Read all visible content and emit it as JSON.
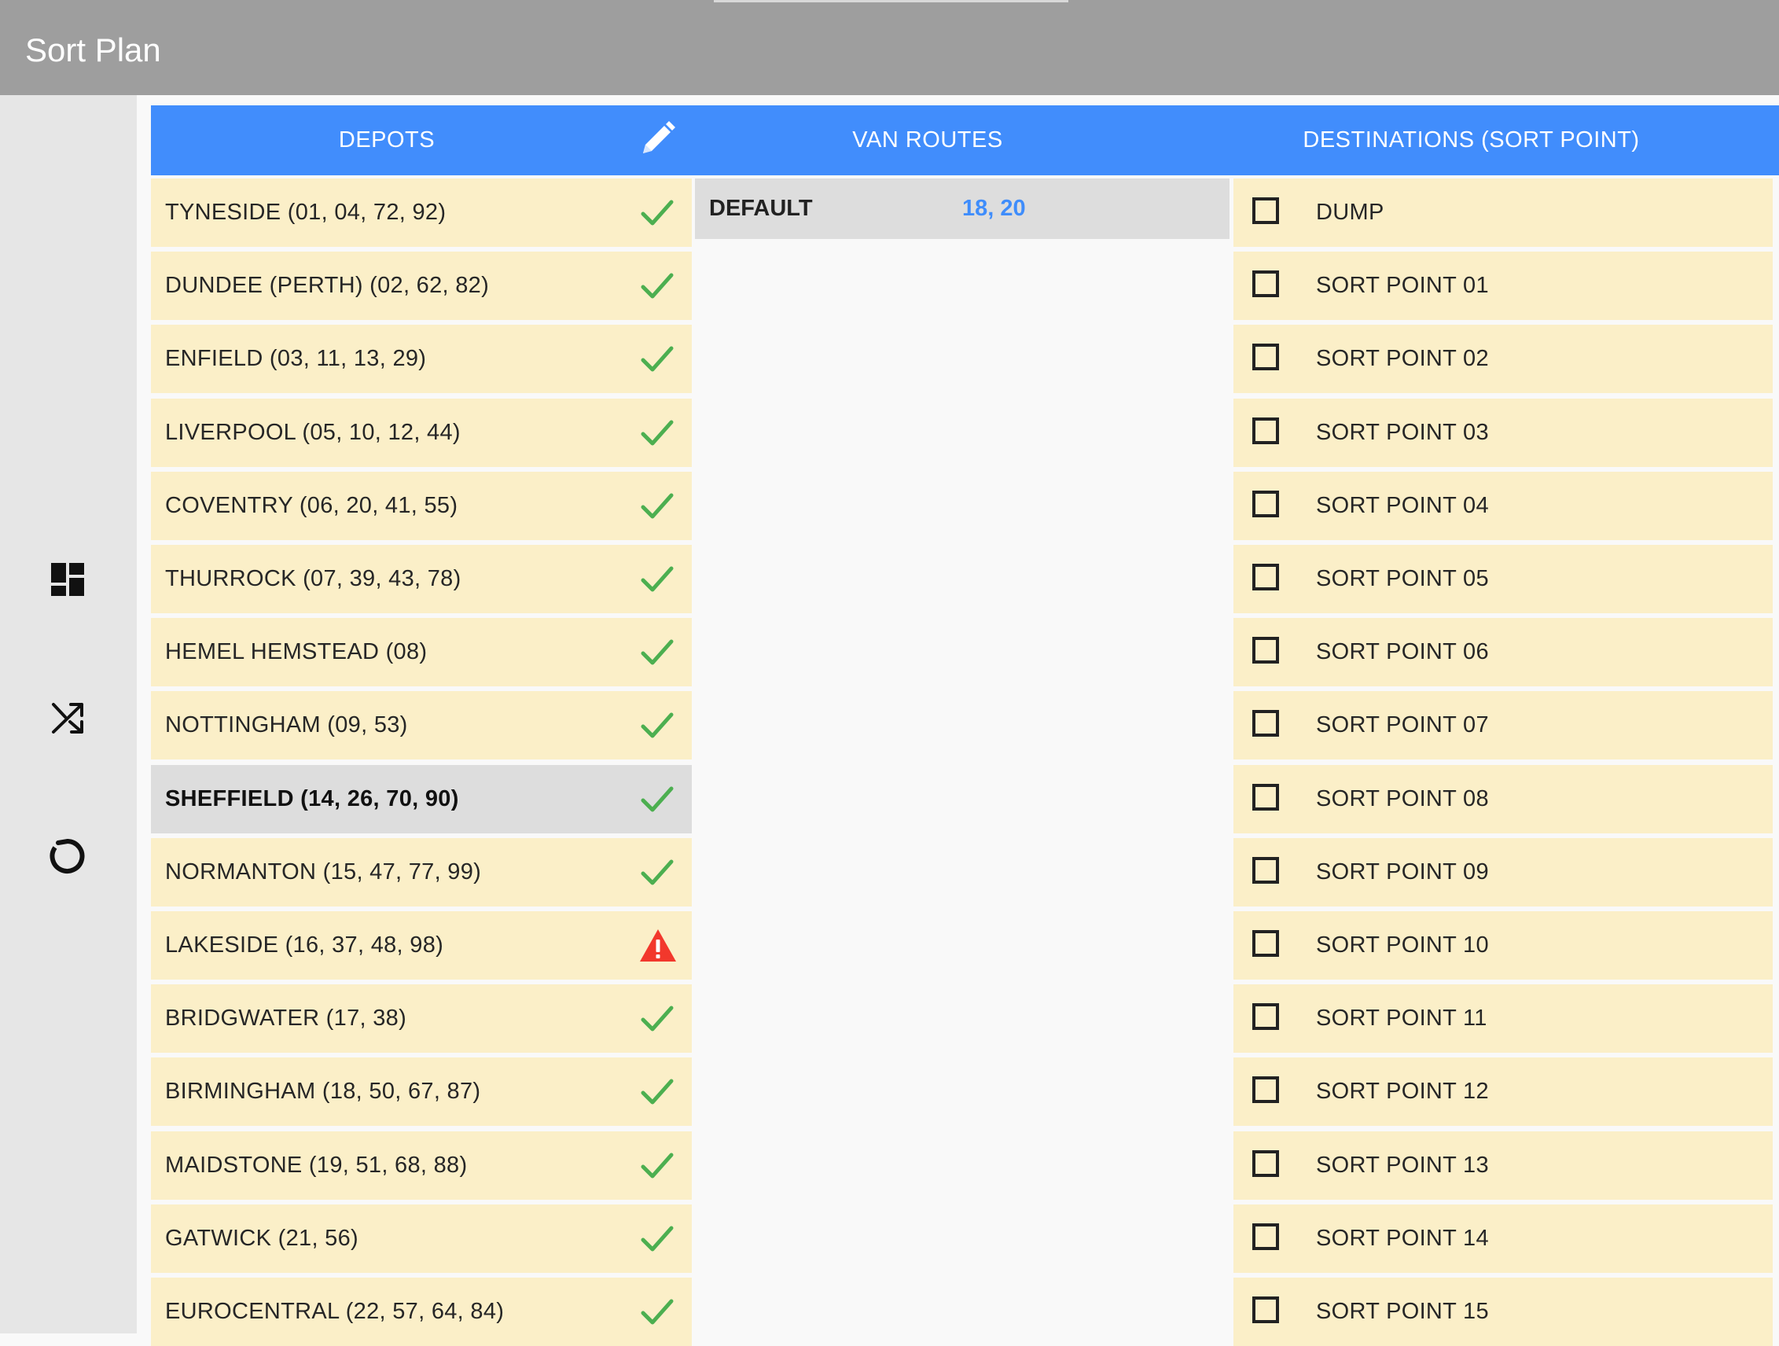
{
  "app": {
    "title": "Sort Plan"
  },
  "sidebar": {
    "items": [
      {
        "icon": "dashboard-icon"
      },
      {
        "icon": "shuffle-icon"
      },
      {
        "icon": "refresh-icon"
      }
    ]
  },
  "headers": {
    "depots": "DEPOTS",
    "van_routes": "VAN ROUTES",
    "destinations": "DESTINATIONS (SORT POINT)"
  },
  "depots": [
    {
      "label": "TYNESIDE (01, 04, 72, 92)",
      "status": "ok"
    },
    {
      "label": "DUNDEE (PERTH) (02, 62, 82)",
      "status": "ok"
    },
    {
      "label": "ENFIELD (03, 11, 13, 29)",
      "status": "ok"
    },
    {
      "label": "LIVERPOOL (05, 10, 12, 44)",
      "status": "ok"
    },
    {
      "label": "COVENTRY (06, 20, 41, 55)",
      "status": "ok"
    },
    {
      "label": "THURROCK (07, 39, 43, 78)",
      "status": "ok"
    },
    {
      "label": "HEMEL HEMSTEAD (08)",
      "status": "ok"
    },
    {
      "label": "NOTTINGHAM (09, 53)",
      "status": "ok"
    },
    {
      "label": "SHEFFIELD (14, 26, 70, 90)",
      "status": "ok",
      "selected": true
    },
    {
      "label": "NORMANTON (15, 47, 77, 99)",
      "status": "ok"
    },
    {
      "label": "LAKESIDE (16, 37, 48, 98)",
      "status": "warning"
    },
    {
      "label": "BRIDGWATER (17, 38)",
      "status": "ok"
    },
    {
      "label": "BIRMINGHAM (18, 50, 67, 87)",
      "status": "ok"
    },
    {
      "label": "MAIDSTONE (19, 51, 68, 88)",
      "status": "ok"
    },
    {
      "label": "GATWICK (21, 56)",
      "status": "ok"
    },
    {
      "label": "EUROCENTRAL (22, 57, 64, 84)",
      "status": "ok"
    }
  ],
  "van_routes": [
    {
      "name": "DEFAULT",
      "value": "18, 20"
    }
  ],
  "destinations": [
    {
      "label": "DUMP",
      "checked": false
    },
    {
      "label": "SORT POINT 01",
      "checked": false
    },
    {
      "label": "SORT POINT 02",
      "checked": false
    },
    {
      "label": "SORT POINT 03",
      "checked": false
    },
    {
      "label": "SORT POINT 04",
      "checked": false
    },
    {
      "label": "SORT POINT 05",
      "checked": false
    },
    {
      "label": "SORT POINT 06",
      "checked": false
    },
    {
      "label": "SORT POINT 07",
      "checked": false
    },
    {
      "label": "SORT POINT 08",
      "checked": false
    },
    {
      "label": "SORT POINT 09",
      "checked": false
    },
    {
      "label": "SORT POINT 10",
      "checked": false
    },
    {
      "label": "SORT POINT 11",
      "checked": false
    },
    {
      "label": "SORT POINT 12",
      "checked": false
    },
    {
      "label": "SORT POINT 13",
      "checked": false
    },
    {
      "label": "SORT POINT 14",
      "checked": false
    },
    {
      "label": "SORT POINT 15",
      "checked": false
    }
  ],
  "colors": {
    "header": "#418dfc",
    "titlebar": "#9e9e9e",
    "row": "#fbefc8",
    "selected_row": "#dddddd",
    "ok": "#4caf50",
    "warning": "#f2382c",
    "route_value": "#3f8dfb"
  }
}
